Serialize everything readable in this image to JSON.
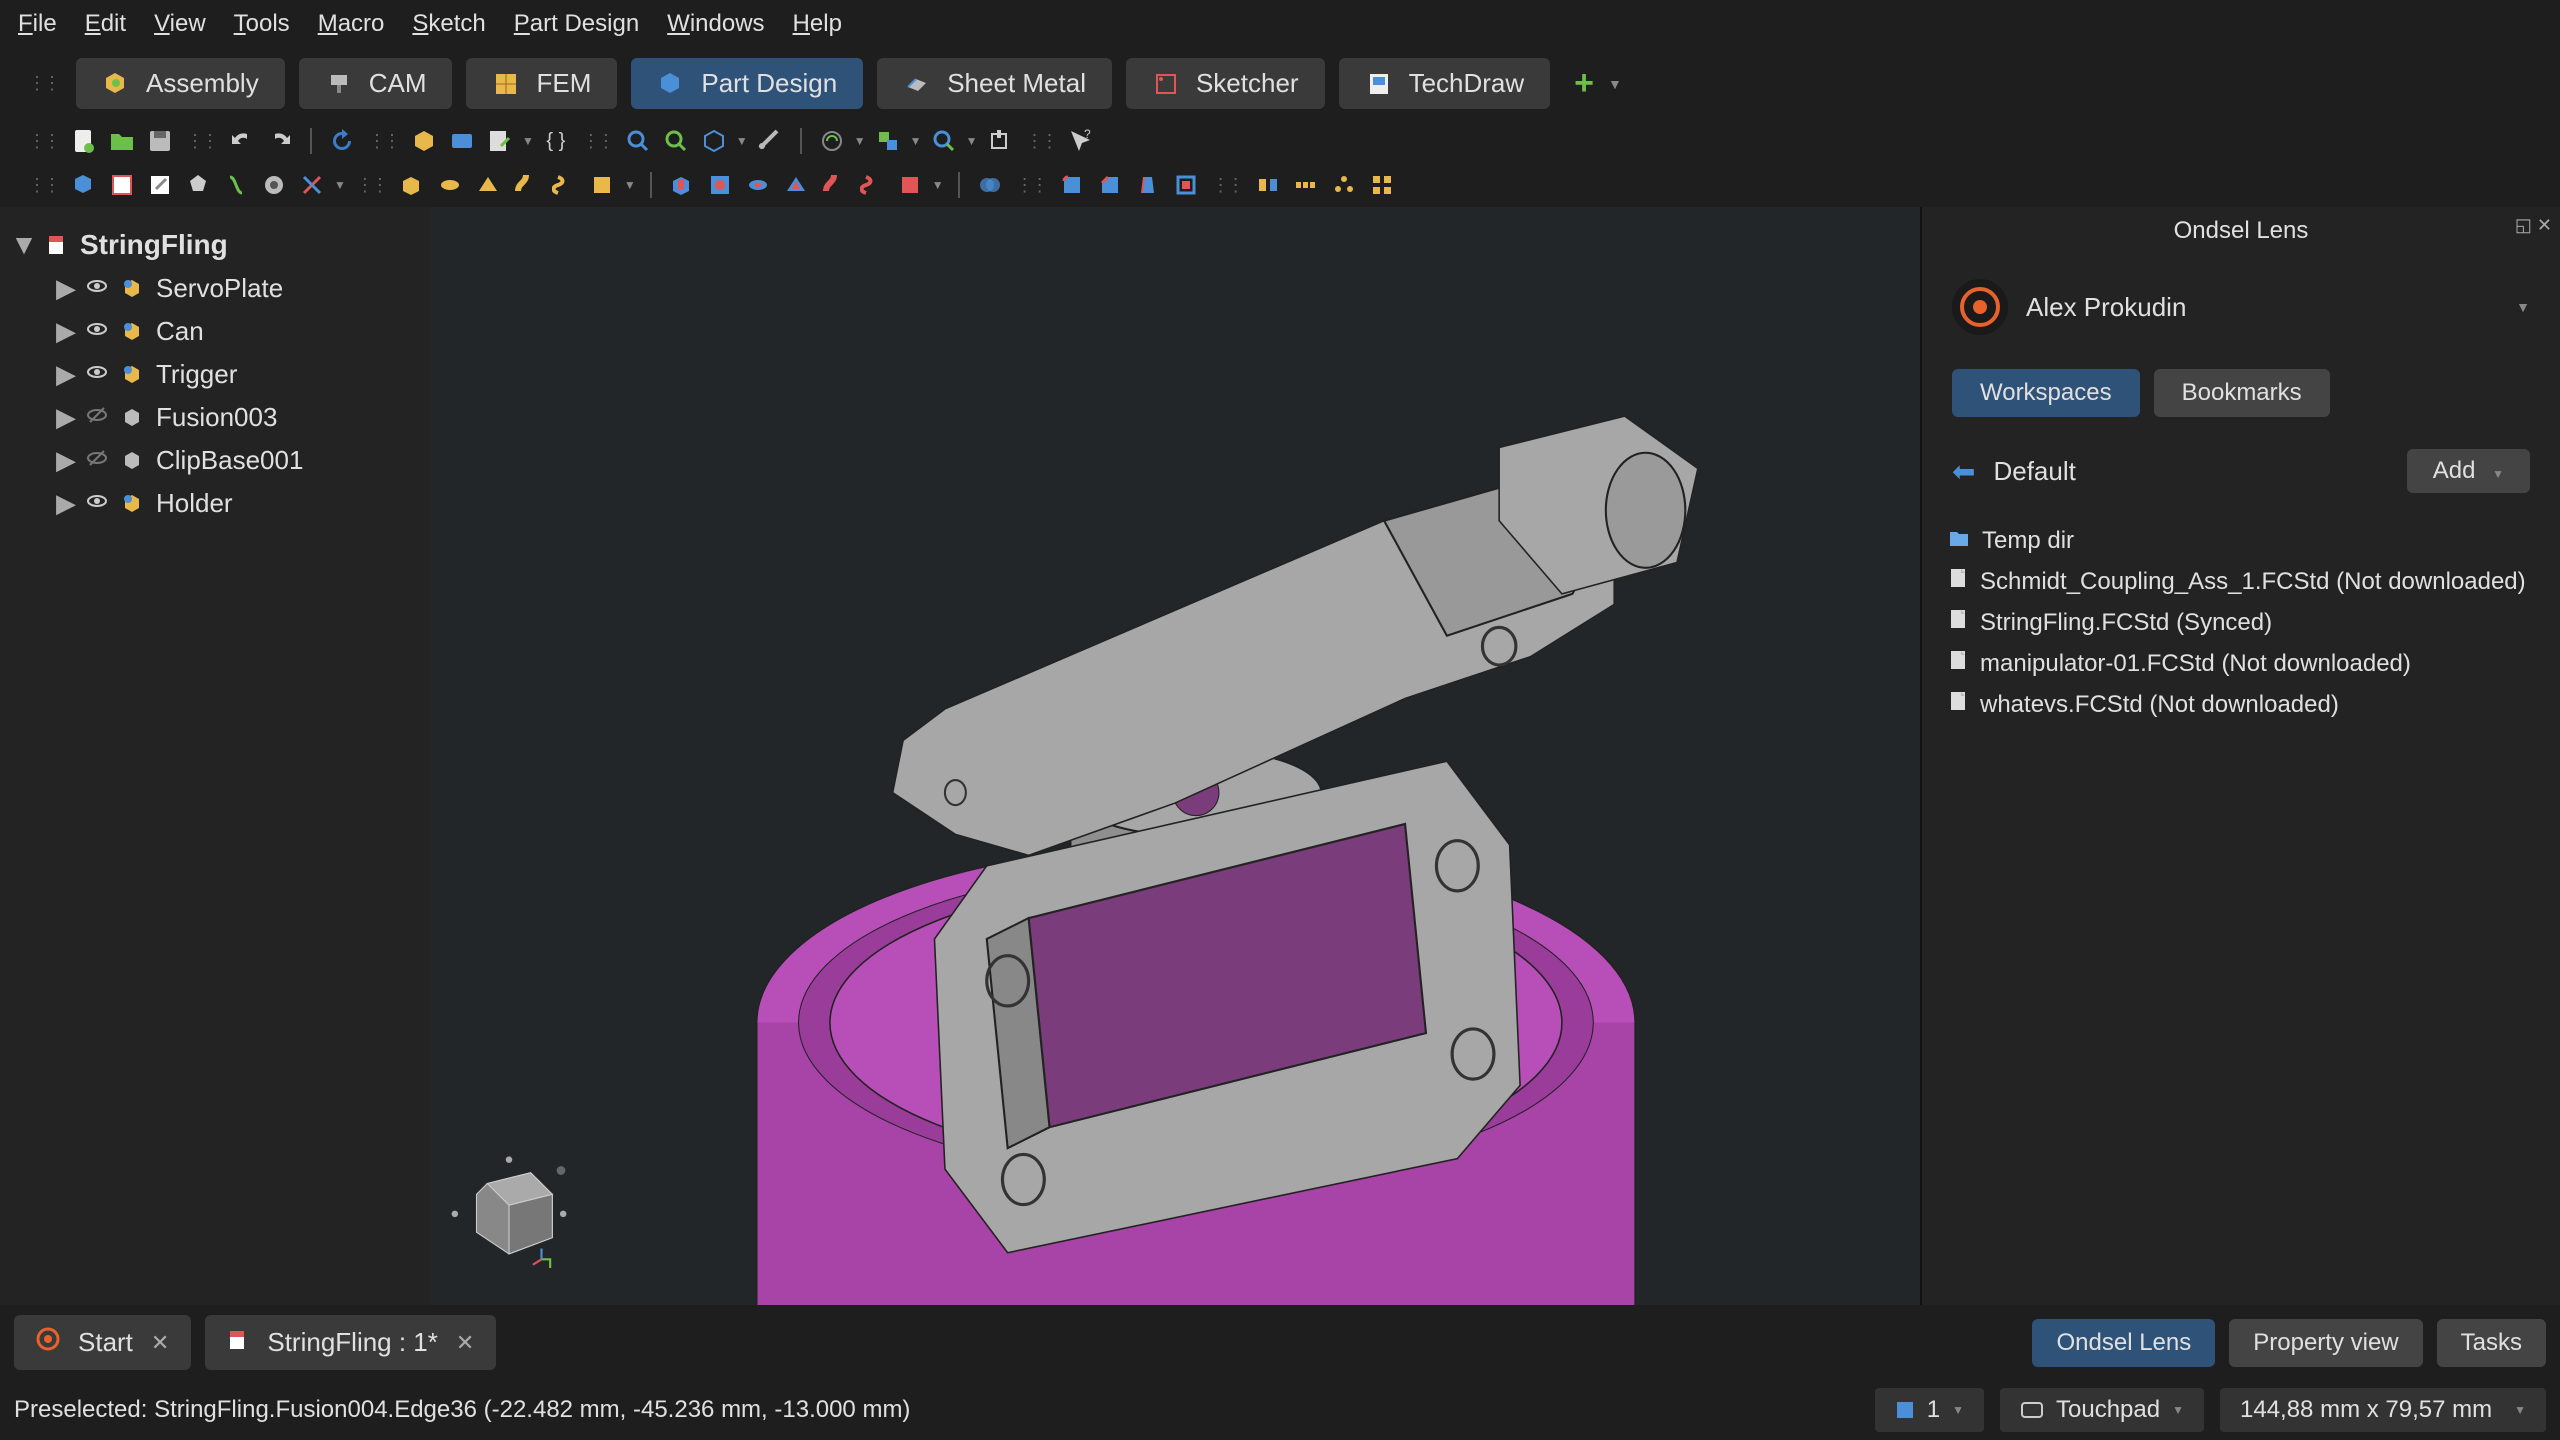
{
  "menu": [
    "File",
    "Edit",
    "View",
    "Tools",
    "Macro",
    "Sketch",
    "Part Design",
    "Windows",
    "Help"
  ],
  "menu_accel": [
    "F",
    "E",
    "V",
    "T",
    "M",
    "S",
    "P",
    "W",
    "H"
  ],
  "workbenches": [
    {
      "label": "Assembly",
      "icon": "assembly",
      "active": false
    },
    {
      "label": "CAM",
      "icon": "cam",
      "active": false
    },
    {
      "label": "FEM",
      "icon": "fem",
      "active": false
    },
    {
      "label": "Part Design",
      "icon": "partdesign",
      "active": true
    },
    {
      "label": "Sheet Metal",
      "icon": "sheetmetal",
      "active": false
    },
    {
      "label": "Sketcher",
      "icon": "sketcher",
      "active": false
    },
    {
      "label": "TechDraw",
      "icon": "techdraw",
      "active": false
    }
  ],
  "tree": {
    "root": "StringFling",
    "items": [
      {
        "label": "ServoPlate",
        "visible": true,
        "type": "body"
      },
      {
        "label": "Can",
        "visible": true,
        "type": "body"
      },
      {
        "label": "Trigger",
        "visible": true,
        "type": "body"
      },
      {
        "label": "Fusion003",
        "visible": false,
        "type": "feature"
      },
      {
        "label": "ClipBase001",
        "visible": false,
        "type": "feature"
      },
      {
        "label": "Holder",
        "visible": true,
        "type": "body"
      }
    ]
  },
  "right_panel": {
    "title": "Ondsel Lens",
    "user": "Alex Prokudin",
    "tabs": [
      {
        "label": "Workspaces",
        "active": true
      },
      {
        "label": "Bookmarks",
        "active": false
      }
    ],
    "breadcrumb": "Default",
    "add_label": "Add",
    "files": [
      {
        "label": "Temp dir",
        "type": "folder"
      },
      {
        "label": "Schmidt_Coupling_Ass_1.FCStd (Not downloaded)",
        "type": "file"
      },
      {
        "label": "StringFling.FCStd (Synced)",
        "type": "file"
      },
      {
        "label": "manipulator-01.FCStd (Not downloaded)",
        "type": "file"
      },
      {
        "label": "whatevs.FCStd (Not downloaded)",
        "type": "file"
      }
    ]
  },
  "doc_tabs": [
    {
      "label": "Start",
      "icon": "ondsel"
    },
    {
      "label": "StringFling : 1*",
      "icon": "doc"
    }
  ],
  "br_buttons": [
    {
      "label": "Ondsel Lens",
      "active": true
    },
    {
      "label": "Property view",
      "active": false
    },
    {
      "label": "Tasks",
      "active": false
    }
  ],
  "status": {
    "preselected": "Preselected: StringFling.Fusion004.Edge36 (-22.482 mm, -45.236 mm, -13.000 mm)",
    "layer": "1",
    "nav": "Touchpad",
    "dims": "144,88 mm x 79,57 mm"
  }
}
